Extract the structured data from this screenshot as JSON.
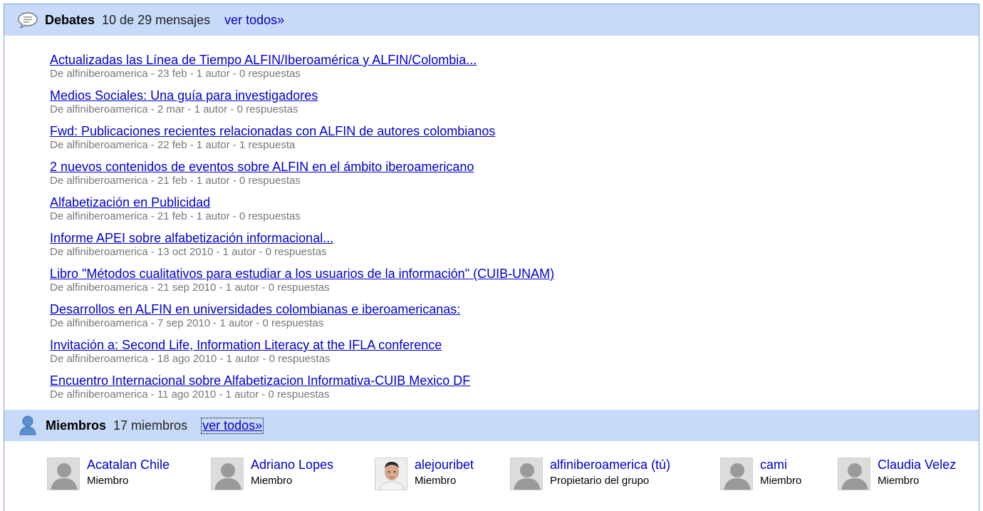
{
  "discussions": {
    "title": "Debates",
    "count": "10 de 29 mensajes",
    "view_all": "ver todos»",
    "icon": "speech-bubble-icon",
    "topics": [
      {
        "title": "Actualizadas las Línea de Tiempo ALFIN/Iberoamérica y ALFIN/Colombia...",
        "meta": "De alfiniberoamerica - 23 feb - 1 autor - 0 respuestas"
      },
      {
        "title": "Medios Sociales: Una guía para investigadores",
        "meta": "De alfiniberoamerica - 2 mar - 1 autor - 0 respuestas"
      },
      {
        "title": "Fwd: Publicaciones recientes relacionadas con ALFIN de autores colombianos",
        "meta": "De alfiniberoamerica - 22 feb - 1 autor - 1 respuesta"
      },
      {
        "title": "2 nuevos contenidos de eventos sobre ALFIN en el ámbito iberoamericano",
        "meta": "De alfiniberoamerica - 21 feb - 1 autor - 0 respuestas"
      },
      {
        "title": "Alfabetización en Publicidad",
        "meta": "De alfiniberoamerica - 21 feb - 1 autor - 0 respuestas"
      },
      {
        "title": "Informe APEI sobre alfabetización informacional...",
        "meta": "De alfiniberoamerica - 13 oct 2010 - 1 autor - 0 respuestas"
      },
      {
        "title": "Libro \"Métodos cualitativos para estudiar a los usuarios de la información\" (CUIB-UNAM)",
        "meta": "De alfiniberoamerica - 21 sep 2010 - 1 autor - 0 respuestas"
      },
      {
        "title": "Desarrollos en ALFIN en universidades colombianas e iberoamericanas:",
        "meta": "De alfiniberoamerica - 7 sep 2010 - 1 autor - 0 respuestas"
      },
      {
        "title": "Invitación a: Second Life, Information Literacy at the IFLA conference",
        "meta": "De alfiniberoamerica - 18 ago 2010 - 1 autor - 0 respuestas"
      },
      {
        "title": "Encuentro Internacional sobre Alfabetizacion Informativa-CUIB Mexico DF",
        "meta": "De alfiniberoamerica - 11 ago 2010 - 1 autor - 0 respuestas"
      }
    ]
  },
  "members": {
    "title": "Miembros",
    "count": "17 miembros",
    "view_all": "ver todos»",
    "icon": "person-icon",
    "list": [
      {
        "name": "Acatalan Chile",
        "role": "Miembro",
        "avatar": "default-avatar"
      },
      {
        "name": "Adriano Lopes",
        "role": "Miembro",
        "avatar": "default-avatar"
      },
      {
        "name": "alejouribet",
        "role": "Miembro",
        "avatar": "photo-avatar"
      },
      {
        "name": "alfiniberoamerica (tú)",
        "role": "Propietario del grupo",
        "avatar": "default-avatar"
      },
      {
        "name": "cami",
        "role": "Miembro",
        "avatar": "default-avatar"
      },
      {
        "name": "Claudia Velez",
        "role": "Miembro",
        "avatar": "default-avatar"
      }
    ]
  },
  "colors": {
    "header_bg": "#c7daf7",
    "link": "#0000cc",
    "meta_text": "#777777",
    "border": "#7aa1dc"
  }
}
